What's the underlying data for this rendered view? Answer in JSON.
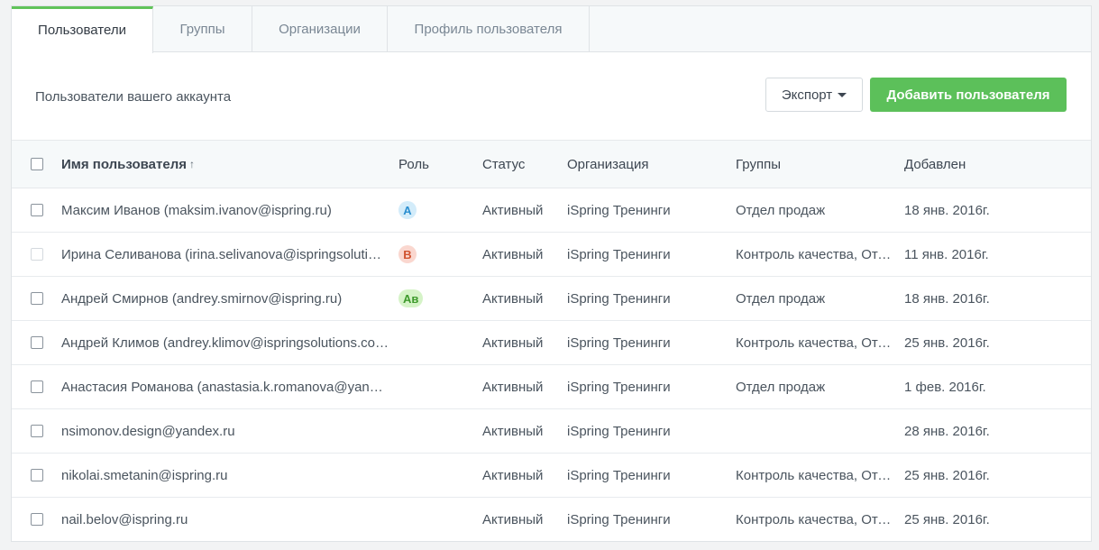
{
  "tabs": [
    {
      "label": "Пользователи",
      "active": true
    },
    {
      "label": "Группы",
      "active": false
    },
    {
      "label": "Организации",
      "active": false
    },
    {
      "label": "Профиль пользователя",
      "active": false
    }
  ],
  "toolbar": {
    "title": "Пользователи вашего аккаунта",
    "export_label": "Экспорт",
    "add_label": "Добавить пользователя"
  },
  "colors": {
    "accent": "#5cc05a",
    "badge_admin_bg": "#d3ecfa",
    "badge_admin_fg": "#2b8fd0",
    "badge_b_bg": "#fad7cf",
    "badge_b_fg": "#d0522f",
    "badge_av_bg": "#d5f3c7",
    "badge_av_fg": "#3e9a2c"
  },
  "table": {
    "headers": {
      "name": "Имя пользователя",
      "name_sort": "↑",
      "role": "Роль",
      "status": "Статус",
      "org": "Организация",
      "groups": "Группы",
      "date": "Добавлен"
    },
    "rows": [
      {
        "name": "Максим Иванов (maksim.ivanov@ispring.ru)",
        "role": "A",
        "role_style": "admin",
        "status": "Активный",
        "org": "iSpring Тренинги",
        "groups": "Отдел продаж",
        "date": "18 янв. 2016г.",
        "checkbox_disabled": false
      },
      {
        "name": "Ирина Селиванова (irina.selivanova@ispringsolutions.com)",
        "role": "B",
        "role_style": "b",
        "status": "Активный",
        "org": "iSpring Тренинги",
        "groups": "Контроль качества, Отдел продаж",
        "date": "11 янв. 2016г.",
        "checkbox_disabled": true
      },
      {
        "name": "Андрей Смирнов (andrey.smirnov@ispring.ru)",
        "role": "Ав",
        "role_style": "av",
        "status": "Активный",
        "org": "iSpring Тренинги",
        "groups": "Отдел продаж",
        "date": "18 янв. 2016г.",
        "checkbox_disabled": false
      },
      {
        "name": "Андрей Климов (andrey.klimov@ispringsolutions.com)",
        "role": "",
        "role_style": "",
        "status": "Активный",
        "org": "iSpring Тренинги",
        "groups": "Контроль качества, Отдел продаж",
        "date": "25 янв. 2016г.",
        "checkbox_disabled": false
      },
      {
        "name": "Анастасия Романова (anastasia.k.romanova@yandex.ru)",
        "role": "",
        "role_style": "",
        "status": "Активный",
        "org": "iSpring Тренинги",
        "groups": "Отдел продаж",
        "date": "1 фев. 2016г.",
        "checkbox_disabled": false
      },
      {
        "name": "nsimonov.design@yandex.ru",
        "role": "",
        "role_style": "",
        "status": "Активный",
        "org": "iSpring Тренинги",
        "groups": "",
        "date": "28 янв. 2016г.",
        "checkbox_disabled": false
      },
      {
        "name": "nikolai.smetanin@ispring.ru",
        "role": "",
        "role_style": "",
        "status": "Активный",
        "org": "iSpring Тренинги",
        "groups": "Контроль качества, Отдел продаж",
        "date": "25 янв. 2016г.",
        "checkbox_disabled": false
      },
      {
        "name": "nail.belov@ispring.ru",
        "role": "",
        "role_style": "",
        "status": "Активный",
        "org": "iSpring Тренинги",
        "groups": "Контроль качества, Отдел продаж",
        "date": "25 янв. 2016г.",
        "checkbox_disabled": false
      }
    ]
  }
}
